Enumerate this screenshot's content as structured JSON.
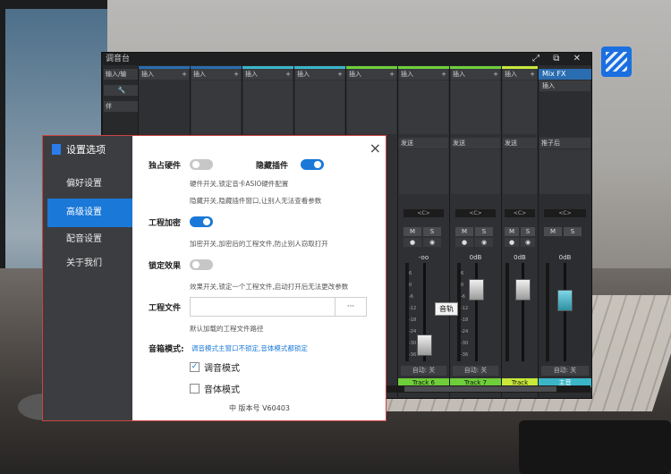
{
  "mixer": {
    "title": "调音台",
    "left_panel": {
      "input_label": "输入/输",
      "channel_label": "伴"
    },
    "insert_label": "插入",
    "send_label": "发送",
    "strips": [
      {
        "id": "s1",
        "send": "",
        "pan": "",
        "name": "",
        "auto": ""
      },
      {
        "id": "s2",
        "send": "",
        "pan": "",
        "name": "",
        "auto": ""
      },
      {
        "id": "s3",
        "send": "",
        "pan": "",
        "name": "",
        "auto": ""
      },
      {
        "id": "s4",
        "send": "发送",
        "pan": "<C>",
        "db": "-oo",
        "auto": "自动: 关",
        "name": "Track 6",
        "ms": [
          "M",
          "S"
        ],
        "ms2": [
          "●",
          "◉"
        ]
      },
      {
        "id": "s5",
        "send": "发送",
        "pan": "<C>",
        "db": "0dB",
        "auto": "自动: 关",
        "name": "Track 7",
        "ms": [
          "M",
          "S"
        ],
        "ms2": [
          "●",
          "◉"
        ]
      },
      {
        "id": "s6",
        "send": "发送",
        "pan": "<C>",
        "db": "0dB",
        "auto": "",
        "name": "Track",
        "ms": [
          "M",
          "S"
        ],
        "ms2": [
          "●",
          "◉"
        ]
      }
    ],
    "fx": {
      "header": "Mix FX",
      "insert": "插入",
      "post": "推子后",
      "pan": "<C>",
      "db": "0dB",
      "auto": "自动: 关",
      "name": "主音",
      "ms": [
        "M",
        "S"
      ]
    },
    "scale": [
      "6",
      "0",
      "-6",
      "-12",
      "-18",
      "-24",
      "-30",
      "-36",
      "-42"
    ],
    "tooltip": "音轨",
    "colors": {
      "blue": "#2a6db0",
      "green": "#6fcf3a",
      "lime": "#c8e83a",
      "cyan": "#3bb6c9"
    }
  },
  "dialog": {
    "brand": "设置选项",
    "close_icon": "×",
    "nav": [
      {
        "label": "偏好设置",
        "active": false
      },
      {
        "label": "高级设置",
        "active": true
      },
      {
        "label": "配音设置",
        "active": false
      },
      {
        "label": "关于我们",
        "active": false
      }
    ],
    "opts": {
      "monitor": {
        "label": "独占硬件",
        "on": false,
        "hint": "硬件开关,锁定音卡ASIO硬件配置"
      },
      "hide": {
        "label": "隐藏插件",
        "on": true,
        "hint": "隐藏开关,隐藏插件窗口,让别人无法查看参数"
      },
      "encrypt": {
        "label": "工程加密",
        "on": true,
        "hint": "加密开关,加密后的工程文件,防止别人窃取打开"
      },
      "lock": {
        "label": "锁定效果",
        "on": false,
        "hint": "效果开关,锁定一个工程文件,启动打开后无法更改参数"
      },
      "project": {
        "label": "工程文件",
        "value": "",
        "browse": "···",
        "hint": "默认加载的工程文件路径"
      }
    },
    "mode": {
      "label": "音箱模式:",
      "note": "调音模式主窗口不锁定,音体模式都锁定"
    },
    "checks": [
      {
        "label": "调音模式",
        "checked": true
      },
      {
        "label": "音体模式",
        "checked": false
      }
    ],
    "version": "中  版本号 V60403"
  }
}
